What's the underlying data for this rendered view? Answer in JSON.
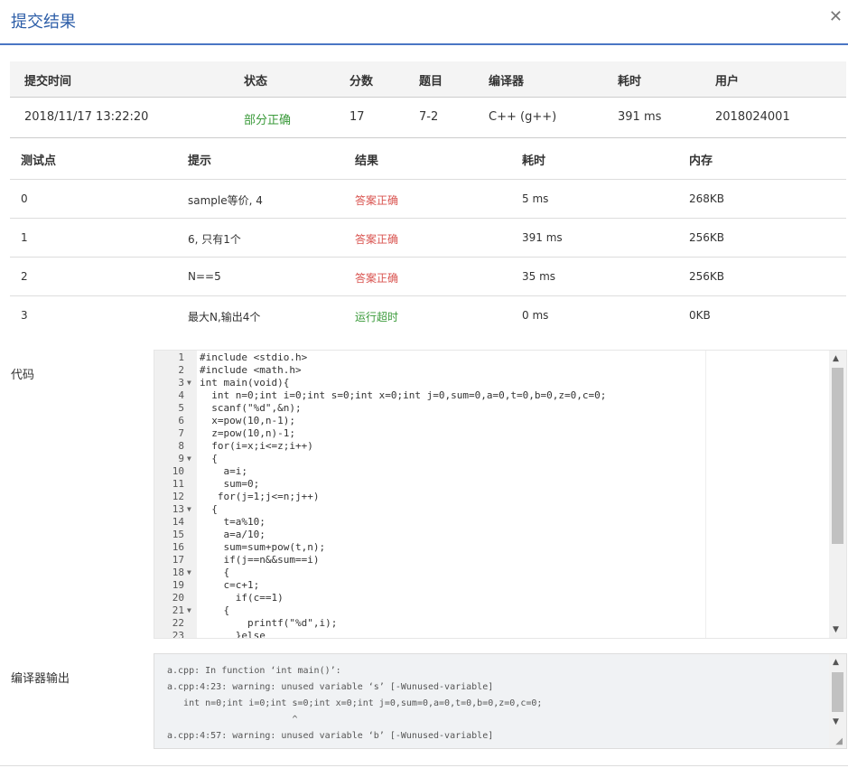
{
  "header": {
    "title": "提交结果"
  },
  "summary": {
    "columns": [
      "提交时间",
      "状态",
      "分数",
      "题目",
      "编译器",
      "耗时",
      "用户"
    ],
    "row": {
      "time": "2018/11/17 13:22:20",
      "status": "部分正确",
      "score": "17",
      "problem": "7-2",
      "compiler": "C++ (g++)",
      "duration": "391 ms",
      "user": "2018024001"
    }
  },
  "cases": {
    "columns": [
      "测试点",
      "提示",
      "结果",
      "耗时",
      "内存"
    ],
    "rows": [
      {
        "id": "0",
        "hint": "sample等价, 4",
        "result": "答案正确",
        "time": "5 ms",
        "mem": "268KB"
      },
      {
        "id": "1",
        "hint": "6, 只有1个",
        "result": "答案正确",
        "time": "391 ms",
        "mem": "256KB"
      },
      {
        "id": "2",
        "hint": "N==5",
        "result": "答案正确",
        "time": "35 ms",
        "mem": "256KB"
      },
      {
        "id": "3",
        "hint": "最大N,输出4个",
        "result": "运行超时",
        "time": "0 ms",
        "mem": "0KB"
      }
    ]
  },
  "labels": {
    "code": "代码",
    "compiler_output": "编译器输出"
  },
  "code": [
    "#include <stdio.h>",
    "#include <math.h>",
    "int main(void){",
    "  int n=0;int i=0;int s=0;int x=0;int j=0,sum=0,a=0,t=0,b=0,z=0,c=0;",
    "  scanf(\"%d\",&n);",
    "  x=pow(10,n-1);",
    "  z=pow(10,n)-1;",
    "  for(i=x;i<=z;i++)",
    "  {",
    "    a=i;",
    "    sum=0;",
    "   for(j=1;j<=n;j++)",
    "  {",
    "    t=a%10;",
    "    a=a/10;",
    "    sum=sum+pow(t,n);",
    "    if(j==n&&sum==i)",
    "    {",
    "    c=c+1;",
    "      if(c==1)",
    "    {",
    "        printf(\"%d\",i);",
    "      }else"
  ],
  "fold_lines": [
    3,
    9,
    13,
    18,
    21
  ],
  "compiler_output": [
    "a.cpp: In function ‘int main()’:",
    "a.cpp:4:23: warning: unused variable ‘s’ [-Wunused-variable]",
    "   int n=0;int i=0;int s=0;int x=0;int j=0,sum=0,a=0,t=0,b=0,z=0,c=0;",
    "                       ^",
    "a.cpp:4:57: warning: unused variable ‘b’ [-Wunused-variable]"
  ]
}
